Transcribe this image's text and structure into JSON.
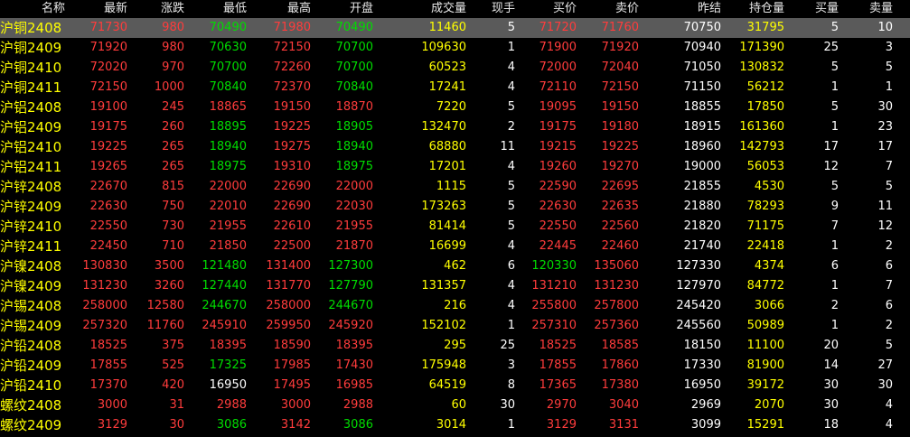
{
  "colors": {
    "background": "#000000",
    "header_text": "#e8e8e8",
    "name_text": "#ffff00",
    "up": "#ff3c3c",
    "down": "#00dd00",
    "flat": "#ffffff",
    "volume": "#ffff00",
    "neutral": "#ffffff",
    "selected_row_bg": "#5a5a5a"
  },
  "columns": [
    {
      "key": "name",
      "label": "名称"
    },
    {
      "key": "last",
      "label": "最新"
    },
    {
      "key": "change",
      "label": "涨跌"
    },
    {
      "key": "low",
      "label": "最低"
    },
    {
      "key": "high",
      "label": "最高"
    },
    {
      "key": "open",
      "label": "开盘"
    },
    {
      "key": "volume",
      "label": "成交量"
    },
    {
      "key": "cur_vol",
      "label": "现手"
    },
    {
      "key": "bid",
      "label": "买价"
    },
    {
      "key": "ask",
      "label": "卖价"
    },
    {
      "key": "prev_settle",
      "label": "昨结"
    },
    {
      "key": "open_interest",
      "label": "持仓量"
    },
    {
      "key": "bid_vol",
      "label": "买量"
    },
    {
      "key": "ask_vol",
      "label": "卖量"
    }
  ],
  "selected_row": 0,
  "rows": [
    {
      "name": "沪铜2408",
      "last": "71730",
      "change": "980",
      "low": "70490",
      "high": "71980",
      "open": "70490",
      "volume": "11460",
      "cur_vol": "5",
      "bid": "71720",
      "ask": "71760",
      "prev_settle": "70750",
      "open_interest": "31795",
      "bid_vol": "5",
      "ask_vol": "10"
    },
    {
      "name": "沪铜2409",
      "last": "71920",
      "change": "980",
      "low": "70630",
      "high": "72150",
      "open": "70700",
      "volume": "109630",
      "cur_vol": "1",
      "bid": "71900",
      "ask": "71920",
      "prev_settle": "70940",
      "open_interest": "171390",
      "bid_vol": "25",
      "ask_vol": "3"
    },
    {
      "name": "沪铜2410",
      "last": "72020",
      "change": "970",
      "low": "70700",
      "high": "72260",
      "open": "70700",
      "volume": "60523",
      "cur_vol": "4",
      "bid": "72000",
      "ask": "72040",
      "prev_settle": "71050",
      "open_interest": "130832",
      "bid_vol": "5",
      "ask_vol": "5"
    },
    {
      "name": "沪铜2411",
      "last": "72150",
      "change": "1000",
      "low": "70840",
      "high": "72370",
      "open": "70840",
      "volume": "17241",
      "cur_vol": "4",
      "bid": "72110",
      "ask": "72150",
      "prev_settle": "71150",
      "open_interest": "56212",
      "bid_vol": "1",
      "ask_vol": "1"
    },
    {
      "name": "沪铝2408",
      "last": "19100",
      "change": "245",
      "low": "18865",
      "high": "19150",
      "open": "18870",
      "volume": "7220",
      "cur_vol": "5",
      "bid": "19095",
      "ask": "19150",
      "prev_settle": "18855",
      "open_interest": "17850",
      "bid_vol": "5",
      "ask_vol": "30"
    },
    {
      "name": "沪铝2409",
      "last": "19175",
      "change": "260",
      "low": "18895",
      "high": "19225",
      "open": "18905",
      "volume": "132470",
      "cur_vol": "2",
      "bid": "19175",
      "ask": "19180",
      "prev_settle": "18915",
      "open_interest": "161360",
      "bid_vol": "1",
      "ask_vol": "23"
    },
    {
      "name": "沪铝2410",
      "last": "19225",
      "change": "265",
      "low": "18940",
      "high": "19275",
      "open": "18940",
      "volume": "68880",
      "cur_vol": "11",
      "bid": "19215",
      "ask": "19225",
      "prev_settle": "18960",
      "open_interest": "142793",
      "bid_vol": "17",
      "ask_vol": "17"
    },
    {
      "name": "沪铝2411",
      "last": "19265",
      "change": "265",
      "low": "18975",
      "high": "19310",
      "open": "18975",
      "volume": "17201",
      "cur_vol": "4",
      "bid": "19260",
      "ask": "19270",
      "prev_settle": "19000",
      "open_interest": "56053",
      "bid_vol": "12",
      "ask_vol": "7"
    },
    {
      "name": "沪锌2408",
      "last": "22670",
      "change": "815",
      "low": "22000",
      "high": "22690",
      "open": "22000",
      "volume": "1115",
      "cur_vol": "5",
      "bid": "22590",
      "ask": "22695",
      "prev_settle": "21855",
      "open_interest": "4530",
      "bid_vol": "5",
      "ask_vol": "5"
    },
    {
      "name": "沪锌2409",
      "last": "22630",
      "change": "750",
      "low": "22010",
      "high": "22690",
      "open": "22030",
      "volume": "173263",
      "cur_vol": "5",
      "bid": "22630",
      "ask": "22635",
      "prev_settle": "21880",
      "open_interest": "78293",
      "bid_vol": "9",
      "ask_vol": "11"
    },
    {
      "name": "沪锌2410",
      "last": "22550",
      "change": "730",
      "low": "21955",
      "high": "22610",
      "open": "21955",
      "volume": "81414",
      "cur_vol": "5",
      "bid": "22550",
      "ask": "22560",
      "prev_settle": "21820",
      "open_interest": "71175",
      "bid_vol": "7",
      "ask_vol": "12"
    },
    {
      "name": "沪锌2411",
      "last": "22450",
      "change": "710",
      "low": "21850",
      "high": "22500",
      "open": "21870",
      "volume": "16699",
      "cur_vol": "4",
      "bid": "22445",
      "ask": "22460",
      "prev_settle": "21740",
      "open_interest": "22418",
      "bid_vol": "1",
      "ask_vol": "2"
    },
    {
      "name": "沪镍2408",
      "last": "130830",
      "change": "3500",
      "low": "121480",
      "high": "131400",
      "open": "127300",
      "volume": "462",
      "cur_vol": "6",
      "bid": "120330",
      "ask": "135060",
      "prev_settle": "127330",
      "open_interest": "4374",
      "bid_vol": "6",
      "ask_vol": "6"
    },
    {
      "name": "沪镍2409",
      "last": "131230",
      "change": "3260",
      "low": "127440",
      "high": "131770",
      "open": "127790",
      "volume": "131357",
      "cur_vol": "4",
      "bid": "131210",
      "ask": "131230",
      "prev_settle": "127970",
      "open_interest": "84772",
      "bid_vol": "1",
      "ask_vol": "7"
    },
    {
      "name": "沪锡2408",
      "last": "258000",
      "change": "12580",
      "low": "244670",
      "high": "258000",
      "open": "244670",
      "volume": "216",
      "cur_vol": "4",
      "bid": "255800",
      "ask": "257800",
      "prev_settle": "245420",
      "open_interest": "3066",
      "bid_vol": "2",
      "ask_vol": "6"
    },
    {
      "name": "沪锡2409",
      "last": "257320",
      "change": "11760",
      "low": "245910",
      "high": "259950",
      "open": "245920",
      "volume": "152102",
      "cur_vol": "1",
      "bid": "257310",
      "ask": "257360",
      "prev_settle": "245560",
      "open_interest": "50989",
      "bid_vol": "1",
      "ask_vol": "2"
    },
    {
      "name": "沪铅2408",
      "last": "18525",
      "change": "375",
      "low": "18395",
      "high": "18590",
      "open": "18395",
      "volume": "295",
      "cur_vol": "25",
      "bid": "18525",
      "ask": "18585",
      "prev_settle": "18150",
      "open_interest": "11100",
      "bid_vol": "20",
      "ask_vol": "5"
    },
    {
      "name": "沪铅2409",
      "last": "17855",
      "change": "525",
      "low": "17325",
      "high": "17985",
      "open": "17430",
      "volume": "175948",
      "cur_vol": "3",
      "bid": "17855",
      "ask": "17860",
      "prev_settle": "17330",
      "open_interest": "81900",
      "bid_vol": "14",
      "ask_vol": "27"
    },
    {
      "name": "沪铅2410",
      "last": "17370",
      "change": "420",
      "low": "16950",
      "high": "17495",
      "open": "16985",
      "volume": "64519",
      "cur_vol": "8",
      "bid": "17365",
      "ask": "17380",
      "prev_settle": "16950",
      "open_interest": "39172",
      "bid_vol": "30",
      "ask_vol": "30"
    },
    {
      "name": "螺纹2408",
      "last": "3000",
      "change": "31",
      "low": "2988",
      "high": "3000",
      "open": "2988",
      "volume": "60",
      "cur_vol": "30",
      "bid": "2970",
      "ask": "3040",
      "prev_settle": "2969",
      "open_interest": "2070",
      "bid_vol": "30",
      "ask_vol": "4"
    },
    {
      "name": "螺纹2409",
      "last": "3129",
      "change": "30",
      "low": "3086",
      "high": "3142",
      "open": "3086",
      "volume": "3014",
      "cur_vol": "1",
      "bid": "3129",
      "ask": "3131",
      "prev_settle": "3099",
      "open_interest": "15291",
      "bid_vol": "18",
      "ask_vol": "4"
    }
  ]
}
